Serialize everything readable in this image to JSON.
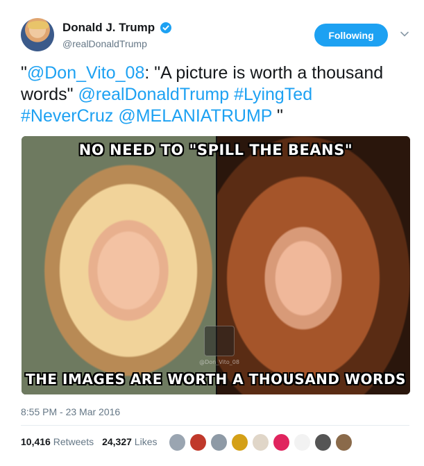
{
  "user": {
    "display_name": "Donald J. Trump",
    "handle": "@realDonaldTrump",
    "verified_color": "#1da1f2"
  },
  "follow_button": {
    "label": "Following"
  },
  "tweet": {
    "segments": [
      {
        "text": "\"",
        "link": false
      },
      {
        "text": "@Don_Vito_08",
        "link": true
      },
      {
        "text": ": \"A picture is worth a thousand words\" ",
        "link": false
      },
      {
        "text": "@realDonaldTrump",
        "link": true
      },
      {
        "text": " ",
        "link": false
      },
      {
        "text": "#LyingTed",
        "link": true
      },
      {
        "text": " ",
        "link": false
      },
      {
        "text": "#NeverCruz",
        "link": true
      },
      {
        "text": "  ",
        "link": false
      },
      {
        "text": "@MELANIATRUMP",
        "link": true
      },
      {
        "text": " \"",
        "link": false
      }
    ]
  },
  "media": {
    "caption_top": "NO NEED TO \"SPILL THE BEANS\"",
    "caption_bottom": "THE IMAGES ARE WORTH A THOUSAND WORDS",
    "watermark": "@Don_Vito_08"
  },
  "timestamp": "8:55 PM - 23 Mar 2016",
  "stats": {
    "retweets_count": "10,416",
    "retweets_label": "Retweets",
    "likes_count": "24,327",
    "likes_label": "Likes"
  },
  "likers": [
    {
      "name": "liker-avatar",
      "color": "#9aa5b1"
    },
    {
      "name": "liker-avatar",
      "color": "#c0392b"
    },
    {
      "name": "liker-avatar",
      "color": "#8e9aa6"
    },
    {
      "name": "liker-avatar",
      "color": "#d4a017"
    },
    {
      "name": "liker-avatar",
      "color": "#e0d6c8"
    },
    {
      "name": "liker-avatar",
      "color": "#e0245e"
    },
    {
      "name": "liker-avatar",
      "color": "#f2f2f2"
    },
    {
      "name": "liker-avatar",
      "color": "#555555"
    },
    {
      "name": "liker-avatar",
      "color": "#8a6a4a"
    }
  ],
  "colors": {
    "accent": "#1da1f2",
    "text": "#14171a",
    "muted": "#657786"
  }
}
